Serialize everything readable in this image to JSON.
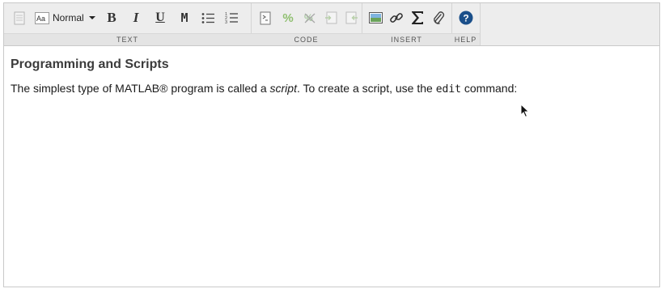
{
  "toolbar": {
    "style_select": "Normal",
    "bold": "B",
    "italic": "I",
    "underline": "U",
    "monospace": "M",
    "groups": {
      "text": "TEXT",
      "code": "CODE",
      "insert": "INSERT",
      "help": "HELP"
    }
  },
  "icons": {
    "text": [
      "page-icon",
      "font-style-icon",
      "dropdown-arrow-icon",
      "bullet-list-icon",
      "numbered-list-icon"
    ],
    "code": [
      "code-block-icon",
      "percent-comment-icon",
      "uncomment-icon",
      "increase-indent-icon",
      "decrease-indent-icon"
    ],
    "insert": [
      "image-icon",
      "link-icon",
      "sigma-equation-icon",
      "attachment-icon"
    ],
    "help": [
      "help-icon"
    ]
  },
  "colors": {
    "help_blue": "#1a4f8a",
    "toolbar_bg": "#ededed",
    "disabled_green": "#8fbf6f"
  },
  "content": {
    "heading": "Programming and Scripts",
    "para_prefix": "The simplest type of MATLAB® program is called a ",
    "para_em": "script",
    "para_mid": ". To create a script, use the ",
    "para_code": "edit",
    "para_suffix": " command:"
  }
}
